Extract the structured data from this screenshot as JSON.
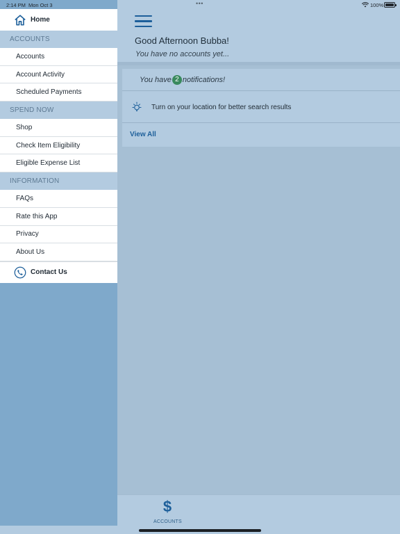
{
  "status_bar": {
    "time": "2:14 PM",
    "date": "Mon Oct 3",
    "dots": "•••",
    "battery_percent": "100%"
  },
  "drawer": {
    "home": "Home",
    "sections": [
      {
        "header": "ACCOUNTS",
        "items": [
          "Accounts",
          "Account Activity",
          "Scheduled Payments"
        ]
      },
      {
        "header": "SPEND NOW",
        "items": [
          "Shop",
          "Check Item Eligibility",
          "Eligible Expense List"
        ]
      },
      {
        "header": "INFORMATION",
        "items": [
          "FAQs",
          "Rate this App",
          "Privacy",
          "About Us"
        ]
      }
    ],
    "contact": "Contact Us"
  },
  "main": {
    "greeting": "Good Afternoon Bubba!",
    "subgreeting": "You have no accounts yet...",
    "notifications": {
      "prefix": "You have",
      "count": "2",
      "suffix": "notifications!"
    },
    "location_prompt": "Turn on your location for better search results",
    "view_all": "View All"
  },
  "tabbar": {
    "accounts_label": "ACCOUNTS"
  },
  "colors": {
    "accent": "#1d5f9a",
    "header_bg": "#b3cbe0",
    "badge": "#3a8a5e"
  }
}
